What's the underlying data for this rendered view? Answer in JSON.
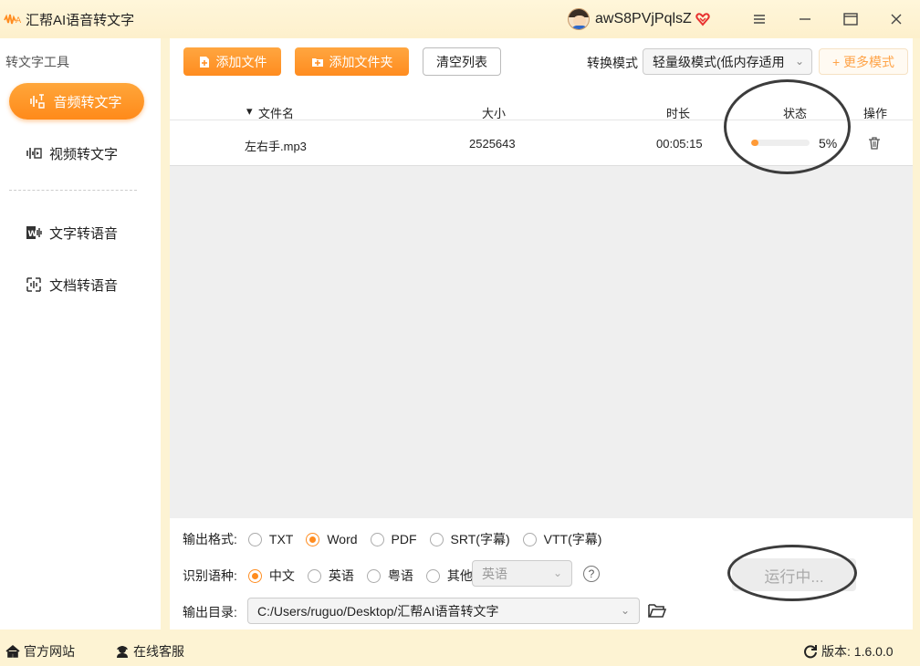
{
  "app": {
    "title": "汇帮AI语音转文字"
  },
  "user": {
    "name": "awS8PVjPqlsZ"
  },
  "sidebar": {
    "title": "转文字工具",
    "items": [
      {
        "label": "音频转文字",
        "icon": "audio-wave-icon",
        "active": true
      },
      {
        "label": "视频转文字",
        "icon": "video-wave-icon",
        "active": false
      },
      {
        "label": "文字转语音",
        "icon": "text-to-speech-icon",
        "active": false
      },
      {
        "label": "文档转语音",
        "icon": "document-speech-icon",
        "active": false
      }
    ]
  },
  "toolbar": {
    "add_file": "添加文件",
    "add_folder": "添加文件夹",
    "clear_list": "清空列表",
    "mode_label": "转换模式",
    "mode_value": "轻量级模式(低内存适用",
    "more_modes": "+ 更多模式"
  },
  "table": {
    "headers": {
      "filename": "文件名",
      "size": "大小",
      "duration": "时长",
      "status": "状态",
      "actions": "操作"
    },
    "rows": [
      {
        "filename": "左右手.mp3",
        "size": "2525643",
        "duration": "00:05:15",
        "progress_percent": 5,
        "progress_text": "5%"
      }
    ]
  },
  "options": {
    "format_label": "输出格式:",
    "formats": [
      {
        "label": "TXT",
        "selected": false
      },
      {
        "label": "Word",
        "selected": true
      },
      {
        "label": "PDF",
        "selected": false
      },
      {
        "label": "SRT(字幕)",
        "selected": false
      },
      {
        "label": "VTT(字幕)",
        "selected": false
      }
    ],
    "language_label": "识别语种:",
    "languages": [
      {
        "label": "中文",
        "selected": true
      },
      {
        "label": "英语",
        "selected": false
      },
      {
        "label": "粤语",
        "selected": false
      },
      {
        "label": "其他",
        "selected": false
      }
    ],
    "other_language_value": "英语",
    "help": "?",
    "output_dir_label": "输出目录:",
    "output_dir_value": "C:/Users/ruguo/Desktop/汇帮AI语音转文字",
    "run_button": "运行中..."
  },
  "footer": {
    "website": "官方网站",
    "support": "在线客服",
    "version": "版本: 1.6.0.0"
  },
  "colors": {
    "accent": "#ff8c1f",
    "background": "#fdf3d3"
  }
}
